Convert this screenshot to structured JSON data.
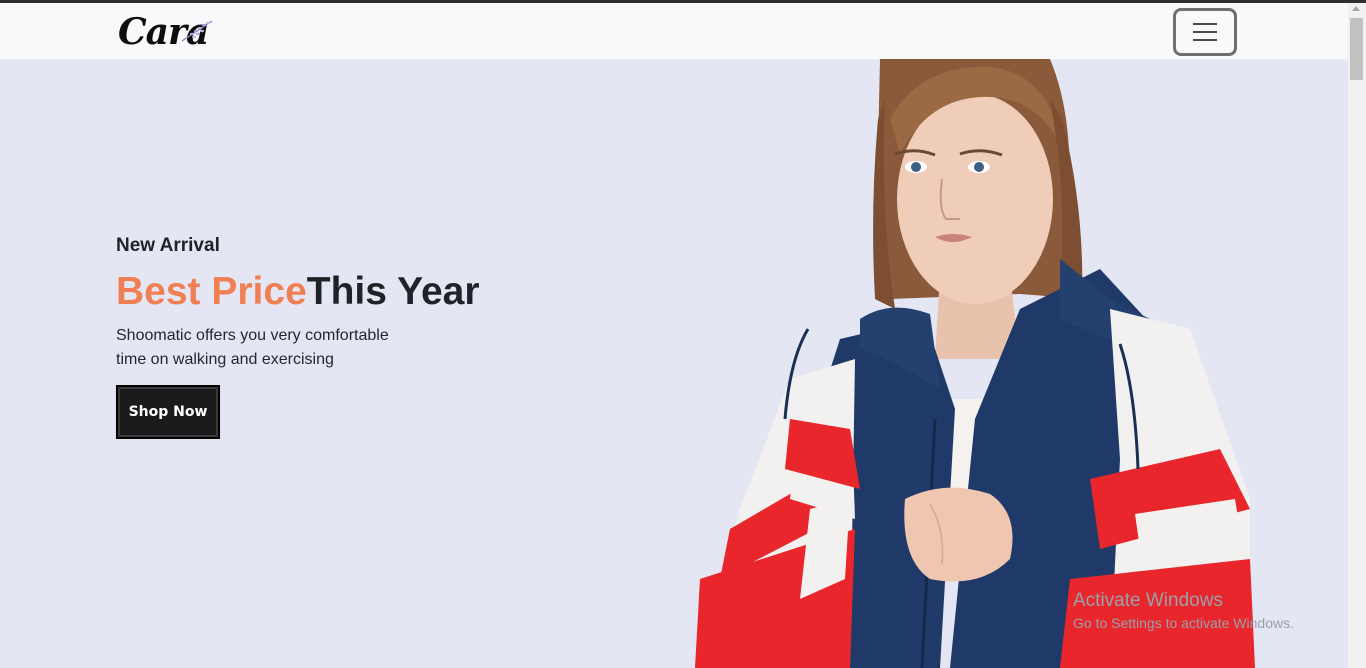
{
  "brand": {
    "logo_text": "Cara"
  },
  "navbar": {
    "menu_icon": "hamburger-icon"
  },
  "hero": {
    "eyebrow": "New Arrival",
    "headline_accent": "Best Price",
    "headline_rest": "This Year",
    "description_line1": "Shoomatic offers you very comfortable",
    "description_line2": "time on walking and exercising",
    "cta_label": "Shop Now",
    "accent_color": "#f07f54",
    "background_color": "#e4e7f3"
  },
  "watermark": {
    "title": "Activate Windows",
    "subtitle": "Go to Settings to activate Windows."
  }
}
